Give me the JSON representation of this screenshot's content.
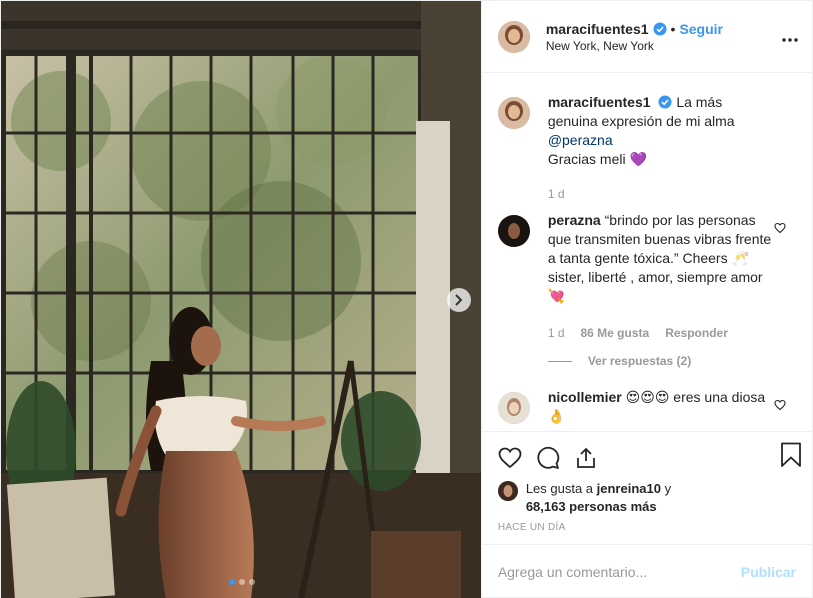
{
  "post_header": {
    "username": "maracifuentes1",
    "separator": "•",
    "follow_label": "Seguir",
    "location": "New York, New York"
  },
  "caption": {
    "username": "maracifuentes1",
    "text": "La más genuina expresión de mi alma",
    "mention": "@perazna",
    "thanks": "Gracias meli ",
    "thanks_emoji": "💜",
    "age": "1 d"
  },
  "comments": [
    {
      "username": "perazna",
      "text": "“brindo por las personas que transmiten buenas vibras frente a tanta gente tóxica.” Cheers 🥂 sister, liberté , amor, siempre amor ",
      "emoji": "💘",
      "age": "1 d",
      "likes": "86 Me gusta",
      "reply_label": "Responder",
      "view_replies": "Ver respuestas (2)"
    },
    {
      "username": "nicollemier",
      "text": " 😍😍😍 eres una diosa ",
      "emoji": "👌"
    }
  ],
  "likes": {
    "prefix": "Les gusta a ",
    "user": "jenreina10",
    "joiner": " y",
    "others": "68,163 personas más"
  },
  "timestamp": "HACE UN DÍA",
  "comment_box": {
    "placeholder": "Agrega un comentario...",
    "publish_label": "Publicar"
  },
  "carousel": {
    "count": 3,
    "active": 1
  },
  "colors": {
    "accent": "#3897f0",
    "verified": "#3897f0",
    "text": "#262626",
    "muted": "#999999"
  }
}
